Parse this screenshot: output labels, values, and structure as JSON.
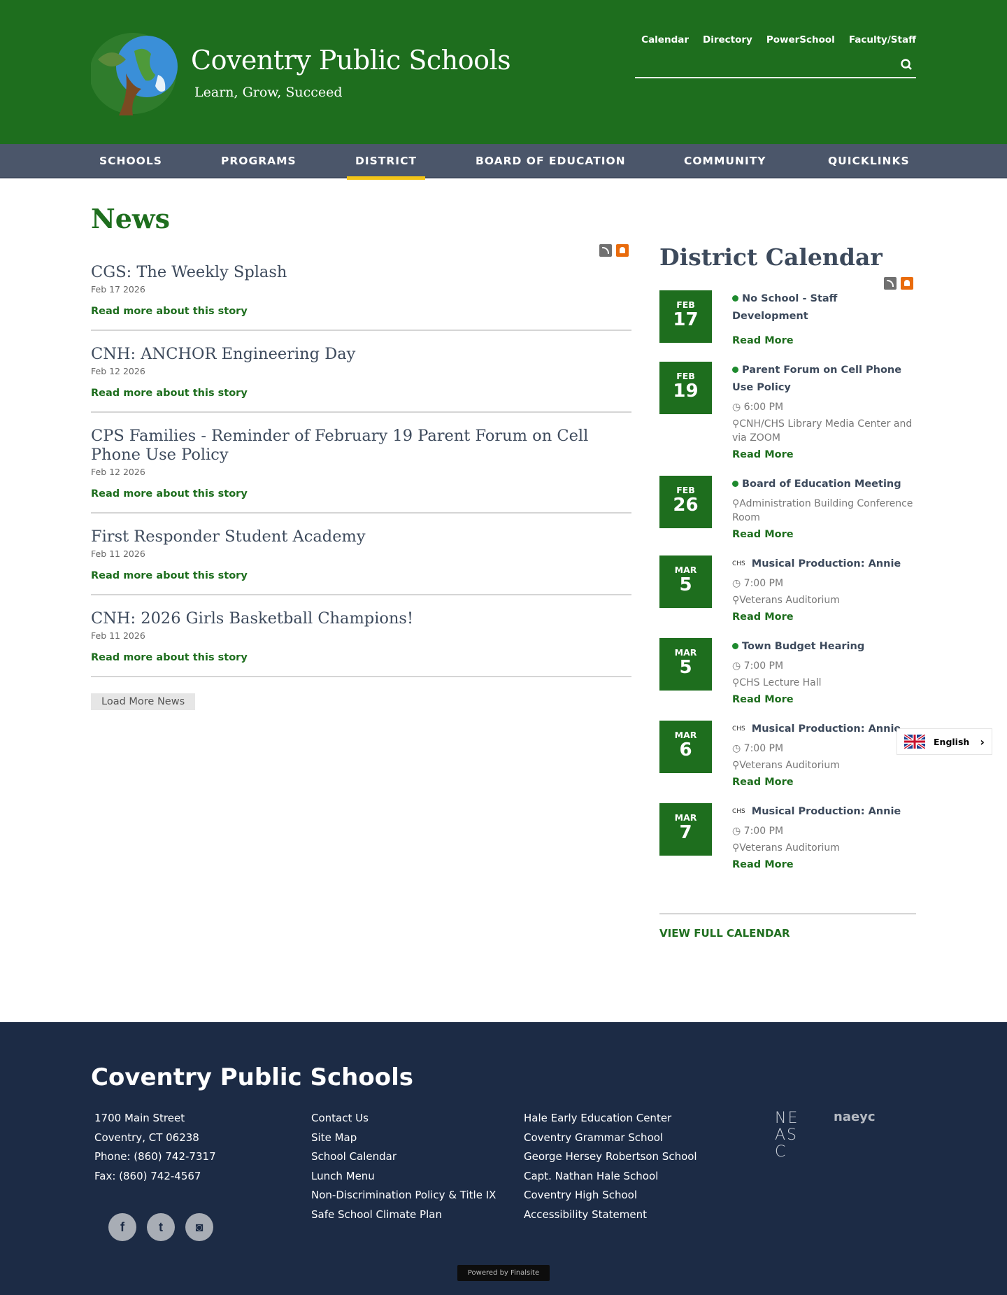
{
  "colors": {
    "brand_green": "#1e6e1e",
    "nav_bg": "#4b566a",
    "active_underline": "#f2c417",
    "footer_bg": "#1c2b45",
    "rss": "#707070",
    "alert": "#e96b0c"
  },
  "header": {
    "title": "Coventry Public Schools",
    "tagline": "Learn, Grow, Succeed",
    "logo_icon": "globe-tree-logo",
    "top_links": [
      "Calendar",
      "Directory",
      "PowerSchool",
      "Faculty/Staff"
    ],
    "search_placeholder": "",
    "search_icon": "search-icon"
  },
  "nav": {
    "items": [
      "SCHOOLS",
      "PROGRAMS",
      "DISTRICT",
      "BOARD OF EDUCATION",
      "COMMUNITY",
      "QUICKLINKS"
    ],
    "active": "DISTRICT"
  },
  "news": {
    "title": "News",
    "items": [
      {
        "title": "CGS: The Weekly Splash",
        "date": "Feb 17 2026",
        "link": "Read more about this story"
      },
      {
        "title": "CNH: ANCHOR Engineering Day",
        "date": "Feb 12 2026",
        "link": "Read more about this story"
      },
      {
        "title": "CPS Families - Reminder of February 19 Parent Forum on Cell Phone Use Policy",
        "date": "Feb 12 2026",
        "link": "Read more about this story"
      },
      {
        "title": "First Responder Student Academy",
        "date": "Feb 11 2026",
        "link": "Read more about this story"
      },
      {
        "title": "CNH: 2026 Girls Basketball Champions!",
        "date": "Feb 11 2026",
        "link": "Read more about this story"
      }
    ],
    "load_more": "Load More News"
  },
  "calendar": {
    "title": "District Calendar",
    "events": [
      {
        "month": "FEB",
        "day": "17",
        "tag": "",
        "title": "No School - Staff Development",
        "time": "",
        "location": "",
        "link": "Read More"
      },
      {
        "month": "FEB",
        "day": "19",
        "tag": "",
        "title": "Parent Forum on Cell Phone Use Policy",
        "time": "6:00 PM",
        "location": "CNH/CHS Library Media Center and via ZOOM",
        "link": "Read More"
      },
      {
        "month": "FEB",
        "day": "26",
        "tag": "",
        "title": "Board of Education Meeting",
        "time": "",
        "location": "Administration Building Conference Room",
        "link": "Read More"
      },
      {
        "month": "MAR",
        "day": "5",
        "tag": "CHS",
        "title": "Musical Production: Annie",
        "time": "7:00 PM",
        "location": "Veterans Auditorium",
        "link": "Read More"
      },
      {
        "month": "MAR",
        "day": "5",
        "tag": "",
        "title": "Town Budget Hearing",
        "time": "7:00 PM",
        "location": "CHS Lecture Hall",
        "link": "Read More"
      },
      {
        "month": "MAR",
        "day": "6",
        "tag": "CHS",
        "title": "Musical Production: Annie",
        "time": "7:00 PM",
        "location": "Veterans Auditorium",
        "link": "Read More"
      },
      {
        "month": "MAR",
        "day": "7",
        "tag": "CHS",
        "title": "Musical Production: Annie",
        "time": "7:00 PM",
        "location": "Veterans Auditorium",
        "link": "Read More"
      }
    ],
    "view_full": "VIEW FULL CALENDAR"
  },
  "language": {
    "label": "English",
    "flag_icon": "uk-flag-icon"
  },
  "footer": {
    "title": "Coventry Public Schools",
    "address": [
      "1700 Main Street",
      "Coventry, CT 06238",
      "Phone: (860) 742-7317",
      "Fax: (860) 742-4567"
    ],
    "links": [
      "Contact Us",
      "Site Map",
      "School Calendar",
      "Lunch Menu",
      "Non-Discrimination Policy & Title IX",
      "Safe School Climate Plan"
    ],
    "schools": [
      "Hale Early Education Center",
      "Coventry Grammar School",
      "George Hersey Robertson School",
      "Capt. Nathan Hale School",
      "Coventry High School",
      "Accessibility Statement"
    ],
    "social": [
      "facebook-icon",
      "twitter-icon",
      "instagram-icon"
    ],
    "badges": {
      "neasc": "NEASC",
      "naeyc": "naeyc"
    },
    "powered": "Powered by Finalsite"
  }
}
